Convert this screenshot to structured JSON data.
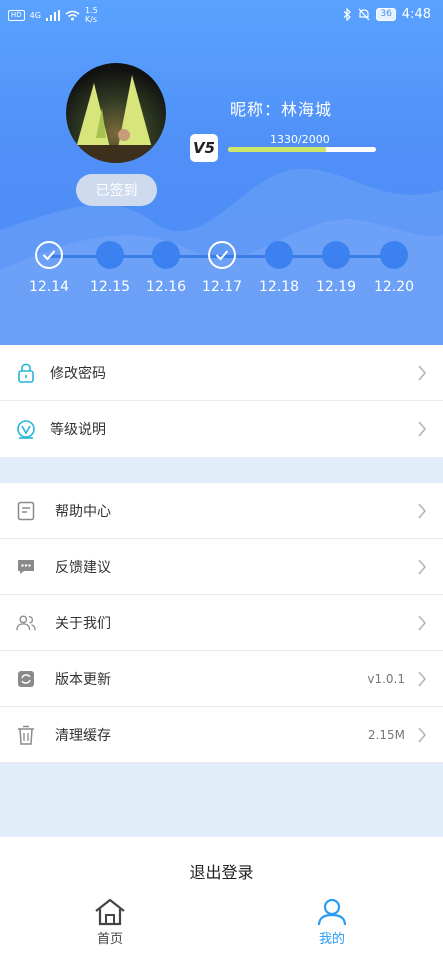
{
  "status_bar": {
    "left_tags": [
      "HD",
      "4G"
    ],
    "speed_value": "1.5",
    "speed_unit": "K/s",
    "battery": "36",
    "time": "4:48"
  },
  "profile": {
    "checkin_label": "已签到",
    "nickname": "昵称：林海城",
    "vip_level": "V5",
    "exp_text": "1330/2000",
    "exp_progress": 0.665
  },
  "checkin_days": [
    {
      "date": "12.14",
      "checked": true
    },
    {
      "date": "12.15",
      "checked": false
    },
    {
      "date": "12.16",
      "checked": false
    },
    {
      "date": "12.17",
      "checked": true
    },
    {
      "date": "12.18",
      "checked": false
    },
    {
      "date": "12.19",
      "checked": false
    },
    {
      "date": "12.20",
      "checked": false
    }
  ],
  "menu_top": [
    {
      "label": "修改密码",
      "icon": "lock-icon"
    },
    {
      "label": "等级说明",
      "icon": "level-icon"
    }
  ],
  "menu_bottom": [
    {
      "label": "帮助中心",
      "icon": "help-doc-icon",
      "value": ""
    },
    {
      "label": "反馈建议",
      "icon": "chat-icon",
      "value": ""
    },
    {
      "label": "关于我们",
      "icon": "users-icon",
      "value": ""
    },
    {
      "label": "版本更新",
      "icon": "refresh-icon",
      "value": "v1.0.1"
    },
    {
      "label": "清理缓存",
      "icon": "trash-icon",
      "value": "2.15M"
    }
  ],
  "logout_label": "退出登录",
  "tabs": [
    {
      "label": "首页",
      "icon": "home-icon",
      "active": false
    },
    {
      "label": "我的",
      "icon": "profile-icon",
      "active": true
    }
  ],
  "colors": {
    "header": "#4d8df5",
    "active_tab": "#2a9df4",
    "inactive_tab": "#444444",
    "exp_fill": "#cde86a",
    "accent_icon": "#27b6d8"
  }
}
